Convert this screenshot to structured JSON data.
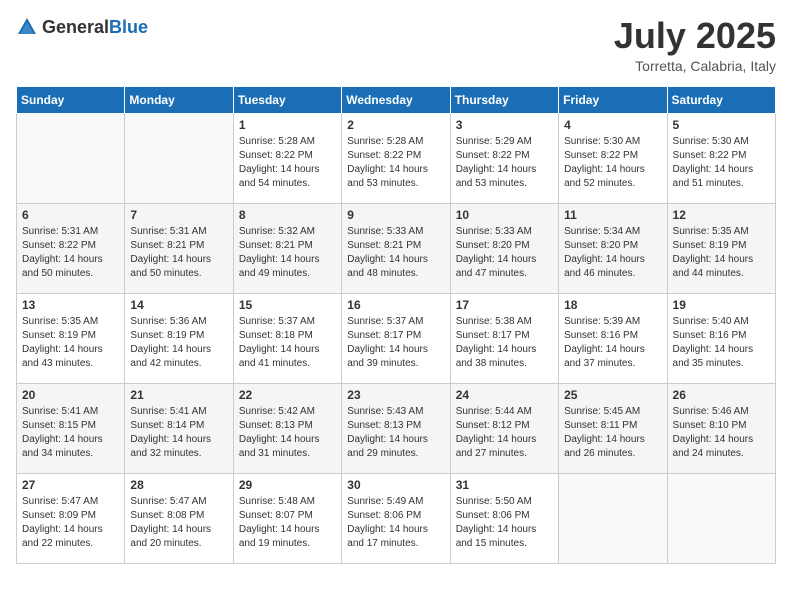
{
  "header": {
    "logo_general": "General",
    "logo_blue": "Blue",
    "month": "July 2025",
    "location": "Torretta, Calabria, Italy"
  },
  "weekdays": [
    "Sunday",
    "Monday",
    "Tuesday",
    "Wednesday",
    "Thursday",
    "Friday",
    "Saturday"
  ],
  "weeks": [
    [
      {
        "day": "",
        "sunrise": "",
        "sunset": "",
        "daylight": ""
      },
      {
        "day": "",
        "sunrise": "",
        "sunset": "",
        "daylight": ""
      },
      {
        "day": "1",
        "sunrise": "Sunrise: 5:28 AM",
        "sunset": "Sunset: 8:22 PM",
        "daylight": "Daylight: 14 hours and 54 minutes."
      },
      {
        "day": "2",
        "sunrise": "Sunrise: 5:28 AM",
        "sunset": "Sunset: 8:22 PM",
        "daylight": "Daylight: 14 hours and 53 minutes."
      },
      {
        "day": "3",
        "sunrise": "Sunrise: 5:29 AM",
        "sunset": "Sunset: 8:22 PM",
        "daylight": "Daylight: 14 hours and 53 minutes."
      },
      {
        "day": "4",
        "sunrise": "Sunrise: 5:30 AM",
        "sunset": "Sunset: 8:22 PM",
        "daylight": "Daylight: 14 hours and 52 minutes."
      },
      {
        "day": "5",
        "sunrise": "Sunrise: 5:30 AM",
        "sunset": "Sunset: 8:22 PM",
        "daylight": "Daylight: 14 hours and 51 minutes."
      }
    ],
    [
      {
        "day": "6",
        "sunrise": "Sunrise: 5:31 AM",
        "sunset": "Sunset: 8:22 PM",
        "daylight": "Daylight: 14 hours and 50 minutes."
      },
      {
        "day": "7",
        "sunrise": "Sunrise: 5:31 AM",
        "sunset": "Sunset: 8:21 PM",
        "daylight": "Daylight: 14 hours and 50 minutes."
      },
      {
        "day": "8",
        "sunrise": "Sunrise: 5:32 AM",
        "sunset": "Sunset: 8:21 PM",
        "daylight": "Daylight: 14 hours and 49 minutes."
      },
      {
        "day": "9",
        "sunrise": "Sunrise: 5:33 AM",
        "sunset": "Sunset: 8:21 PM",
        "daylight": "Daylight: 14 hours and 48 minutes."
      },
      {
        "day": "10",
        "sunrise": "Sunrise: 5:33 AM",
        "sunset": "Sunset: 8:20 PM",
        "daylight": "Daylight: 14 hours and 47 minutes."
      },
      {
        "day": "11",
        "sunrise": "Sunrise: 5:34 AM",
        "sunset": "Sunset: 8:20 PM",
        "daylight": "Daylight: 14 hours and 46 minutes."
      },
      {
        "day": "12",
        "sunrise": "Sunrise: 5:35 AM",
        "sunset": "Sunset: 8:19 PM",
        "daylight": "Daylight: 14 hours and 44 minutes."
      }
    ],
    [
      {
        "day": "13",
        "sunrise": "Sunrise: 5:35 AM",
        "sunset": "Sunset: 8:19 PM",
        "daylight": "Daylight: 14 hours and 43 minutes."
      },
      {
        "day": "14",
        "sunrise": "Sunrise: 5:36 AM",
        "sunset": "Sunset: 8:19 PM",
        "daylight": "Daylight: 14 hours and 42 minutes."
      },
      {
        "day": "15",
        "sunrise": "Sunrise: 5:37 AM",
        "sunset": "Sunset: 8:18 PM",
        "daylight": "Daylight: 14 hours and 41 minutes."
      },
      {
        "day": "16",
        "sunrise": "Sunrise: 5:37 AM",
        "sunset": "Sunset: 8:17 PM",
        "daylight": "Daylight: 14 hours and 39 minutes."
      },
      {
        "day": "17",
        "sunrise": "Sunrise: 5:38 AM",
        "sunset": "Sunset: 8:17 PM",
        "daylight": "Daylight: 14 hours and 38 minutes."
      },
      {
        "day": "18",
        "sunrise": "Sunrise: 5:39 AM",
        "sunset": "Sunset: 8:16 PM",
        "daylight": "Daylight: 14 hours and 37 minutes."
      },
      {
        "day": "19",
        "sunrise": "Sunrise: 5:40 AM",
        "sunset": "Sunset: 8:16 PM",
        "daylight": "Daylight: 14 hours and 35 minutes."
      }
    ],
    [
      {
        "day": "20",
        "sunrise": "Sunrise: 5:41 AM",
        "sunset": "Sunset: 8:15 PM",
        "daylight": "Daylight: 14 hours and 34 minutes."
      },
      {
        "day": "21",
        "sunrise": "Sunrise: 5:41 AM",
        "sunset": "Sunset: 8:14 PM",
        "daylight": "Daylight: 14 hours and 32 minutes."
      },
      {
        "day": "22",
        "sunrise": "Sunrise: 5:42 AM",
        "sunset": "Sunset: 8:13 PM",
        "daylight": "Daylight: 14 hours and 31 minutes."
      },
      {
        "day": "23",
        "sunrise": "Sunrise: 5:43 AM",
        "sunset": "Sunset: 8:13 PM",
        "daylight": "Daylight: 14 hours and 29 minutes."
      },
      {
        "day": "24",
        "sunrise": "Sunrise: 5:44 AM",
        "sunset": "Sunset: 8:12 PM",
        "daylight": "Daylight: 14 hours and 27 minutes."
      },
      {
        "day": "25",
        "sunrise": "Sunrise: 5:45 AM",
        "sunset": "Sunset: 8:11 PM",
        "daylight": "Daylight: 14 hours and 26 minutes."
      },
      {
        "day": "26",
        "sunrise": "Sunrise: 5:46 AM",
        "sunset": "Sunset: 8:10 PM",
        "daylight": "Daylight: 14 hours and 24 minutes."
      }
    ],
    [
      {
        "day": "27",
        "sunrise": "Sunrise: 5:47 AM",
        "sunset": "Sunset: 8:09 PM",
        "daylight": "Daylight: 14 hours and 22 minutes."
      },
      {
        "day": "28",
        "sunrise": "Sunrise: 5:47 AM",
        "sunset": "Sunset: 8:08 PM",
        "daylight": "Daylight: 14 hours and 20 minutes."
      },
      {
        "day": "29",
        "sunrise": "Sunrise: 5:48 AM",
        "sunset": "Sunset: 8:07 PM",
        "daylight": "Daylight: 14 hours and 19 minutes."
      },
      {
        "day": "30",
        "sunrise": "Sunrise: 5:49 AM",
        "sunset": "Sunset: 8:06 PM",
        "daylight": "Daylight: 14 hours and 17 minutes."
      },
      {
        "day": "31",
        "sunrise": "Sunrise: 5:50 AM",
        "sunset": "Sunset: 8:06 PM",
        "daylight": "Daylight: 14 hours and 15 minutes."
      },
      {
        "day": "",
        "sunrise": "",
        "sunset": "",
        "daylight": ""
      },
      {
        "day": "",
        "sunrise": "",
        "sunset": "",
        "daylight": ""
      }
    ]
  ]
}
